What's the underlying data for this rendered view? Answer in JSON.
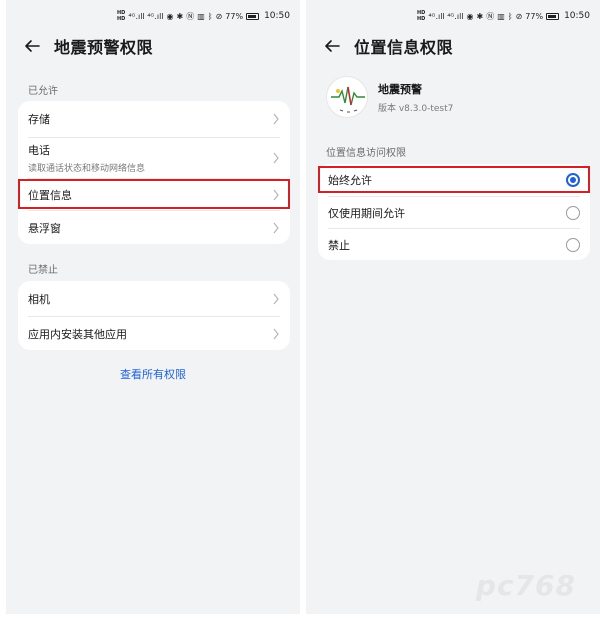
{
  "status_bar": {
    "sim1": "HD",
    "sim2": "HD",
    "signal": "⁴ᴳ.ıll ⁴ᴳ.ıll",
    "icons": [
      "vpn-icon",
      "settings-icon",
      "nfc-icon",
      "vibrate-icon",
      "bluetooth-icon",
      "dnd-icon"
    ],
    "battery": "77%",
    "time": "10:50"
  },
  "left": {
    "title": "地震预警权限",
    "allowed_label": "已允许",
    "allowed_items": [
      {
        "label": "存储",
        "sub": ""
      },
      {
        "label": "电话",
        "sub": "读取通话状态和移动网络信息"
      },
      {
        "label": "位置信息",
        "sub": ""
      },
      {
        "label": "悬浮窗",
        "sub": ""
      }
    ],
    "denied_label": "已禁止",
    "denied_items": [
      {
        "label": "相机"
      },
      {
        "label": "应用内安装其他应用"
      }
    ],
    "view_all": "查看所有权限"
  },
  "right": {
    "title": "位置信息权限",
    "app_name": "地震预警",
    "app_version": "版本 v8.3.0-test7",
    "section_label": "位置信息访问权限",
    "options": [
      {
        "label": "始终允许",
        "selected": true
      },
      {
        "label": "仅使用期间允许",
        "selected": false
      },
      {
        "label": "禁止",
        "selected": false
      }
    ]
  },
  "watermark": "pc768",
  "colors": {
    "accent": "#1f62d8",
    "highlight": "#d61e25",
    "background": "#f1f3f5"
  }
}
